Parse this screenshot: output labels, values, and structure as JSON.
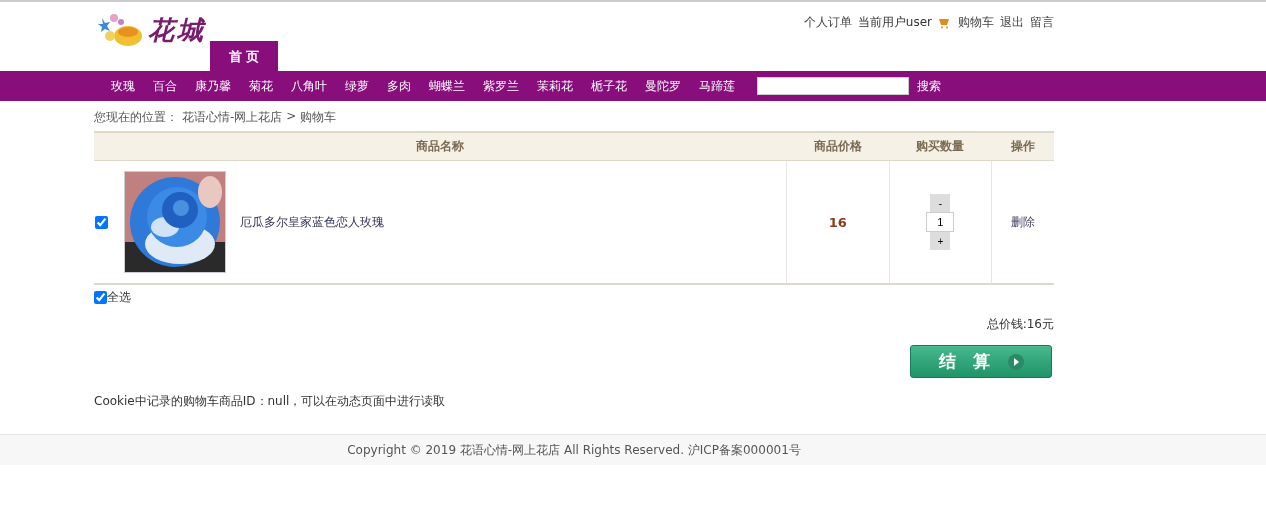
{
  "logo": {
    "text": "花城"
  },
  "top_links": [
    {
      "kind": "link",
      "label": "个人订单"
    },
    {
      "kind": "text",
      "label": "当前用户user"
    },
    {
      "kind": "cart",
      "label": "购物车"
    },
    {
      "kind": "link",
      "label": "退出"
    },
    {
      "kind": "link",
      "label": "留言"
    }
  ],
  "home_tab": {
    "label": "首 页",
    "selected": true
  },
  "nav": [
    "玫瑰",
    "百合",
    "康乃馨",
    "菊花",
    "八角叶",
    "绿萝",
    "多肉",
    "蝴蝶兰",
    "紫罗兰",
    "茉莉花",
    "栀子花",
    "曼陀罗",
    "马蹄莲"
  ],
  "search": {
    "button": "搜索"
  },
  "breadcrumb": {
    "prefix": "您现在的位置：",
    "site": "花语心情-网上花店",
    "separator": ">",
    "current": "购物车"
  },
  "table": {
    "columns": [
      "商品名称",
      "商品价格",
      "购买数量",
      "操作"
    ],
    "rows": [
      {
        "checked": true,
        "name": "厄瓜多尔皇家蓝色恋人玫瑰",
        "price": "16",
        "minus": "-",
        "quantity": "1",
        "plus": "+",
        "action": "删除"
      }
    ]
  },
  "select_all": {
    "label": "全选",
    "checked": true
  },
  "total": "总价钱:16元",
  "checkout": {
    "label": "结　算"
  },
  "cookie_note": "Cookie中记录的购物车商品ID：null，可以在动态页面中进行读取",
  "footer": "Copyright © 2019 花语心情-网上花店 All Rights Reserved. 沪ICP备案000001号"
}
